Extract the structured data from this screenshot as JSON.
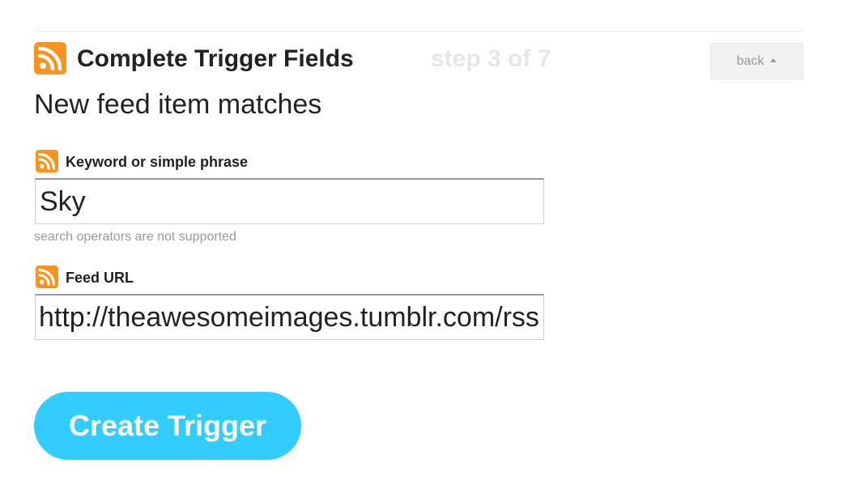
{
  "header": {
    "title": "Complete Trigger Fields",
    "step": "step 3 of 7",
    "back_label": "back",
    "icon": "rss-feed-icon"
  },
  "subtitle": "New feed item matches",
  "fields": [
    {
      "label": "Keyword or simple phrase",
      "value": "Sky",
      "helper": "search operators are not supported",
      "icon": "rss-feed-icon"
    },
    {
      "label": "Feed URL",
      "value": "http://theawesomeimages.tumblr.com/rss",
      "icon": "rss-feed-icon"
    }
  ],
  "submit_label": "Create Trigger",
  "colors": {
    "rss_orange": "#f7931e",
    "button_blue": "#33ccff",
    "step_gray": "#e6e6e6",
    "helper_gray": "#999999"
  }
}
